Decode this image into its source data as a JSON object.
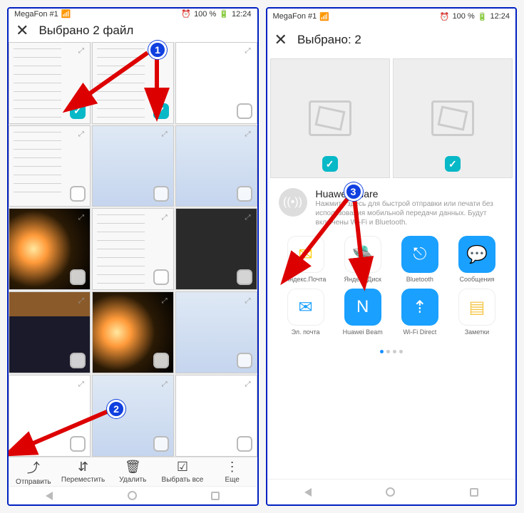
{
  "status": {
    "carrier": "MegaFon #1",
    "signal_icon": "signal-icon",
    "alarm_icon": "alarm-icon",
    "battery": "100 %",
    "batt_icon": "⚡",
    "time": "12:24"
  },
  "left": {
    "title": "Выбрано 2 файл",
    "thumbs": [
      {
        "cls": "settings",
        "checked": true
      },
      {
        "cls": "settings",
        "checked": true
      },
      {
        "cls": "white",
        "checked": false
      },
      {
        "cls": "settings",
        "checked": false
      },
      {
        "cls": "home",
        "checked": false
      },
      {
        "cls": "home",
        "checked": false
      },
      {
        "cls": "space",
        "checked": false
      },
      {
        "cls": "settings",
        "checked": false
      },
      {
        "cls": "dark",
        "checked": false
      },
      {
        "cls": "game",
        "checked": false
      },
      {
        "cls": "space",
        "checked": false
      },
      {
        "cls": "home",
        "checked": false
      },
      {
        "cls": "white",
        "checked": false
      },
      {
        "cls": "home",
        "checked": false
      },
      {
        "cls": "white",
        "checked": false
      }
    ],
    "bottombar": [
      {
        "icon": "share",
        "glyph": "⤴",
        "label": "Отправить"
      },
      {
        "icon": "move",
        "glyph": "⇵",
        "label": "Переместить"
      },
      {
        "icon": "delete",
        "glyph": "🗑",
        "label": "Удалить"
      },
      {
        "icon": "select-all",
        "glyph": "☑",
        "label": "Выбрать все"
      },
      {
        "icon": "more",
        "glyph": "⋮",
        "label": "Еще"
      }
    ]
  },
  "right": {
    "title": "Выбрано: 2",
    "huawei": {
      "title": "Huawei Share",
      "desc": "Нажмите здесь для быстрой отправки или печати без использования мобильной передачи данных. Будут включены Wi-Fi и Bluetooth."
    },
    "share": [
      {
        "label": "Яндекс.Почта",
        "bg": "#fff",
        "glyph": "✉",
        "fg": "#ffcc00",
        "border": "1px solid #eee"
      },
      {
        "label": "Яндекс.Диск",
        "bg": "#fff",
        "glyph": "🛸",
        "fg": "#2a7ad4",
        "border": "1px solid #eee"
      },
      {
        "label": "Bluetooth",
        "bg": "#1aa0ff",
        "glyph": "⎋",
        "fg": "#fff"
      },
      {
        "label": "Сообщения",
        "bg": "#1aa0ff",
        "glyph": "💬",
        "fg": "#fff"
      },
      {
        "label": "Эл. почта",
        "bg": "#fff",
        "glyph": "✉",
        "fg": "#1aa0ff",
        "border": "1px solid #eee"
      },
      {
        "label": "Huawei Beam",
        "bg": "#1aa0ff",
        "glyph": "N",
        "fg": "#fff"
      },
      {
        "label": "Wi-Fi Direct",
        "bg": "#1aa0ff",
        "glyph": "⇡",
        "fg": "#fff"
      },
      {
        "label": "Заметки",
        "bg": "#fff",
        "glyph": "▤",
        "fg": "#f5c74a",
        "border": "1px solid #eee"
      }
    ]
  },
  "annotations": {
    "b1": "1",
    "b2": "2",
    "b3": "3"
  }
}
